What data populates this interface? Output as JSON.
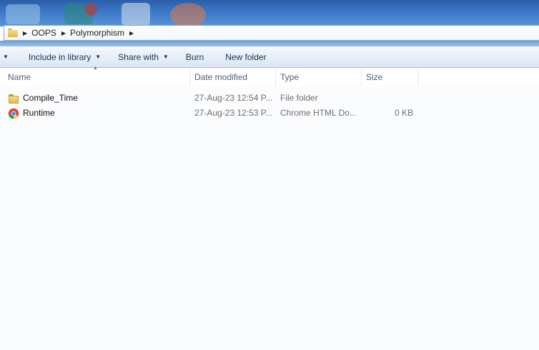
{
  "addressbar": {
    "crumbs": [
      {
        "label": "OOPS"
      },
      {
        "label": "Polymorphism"
      }
    ]
  },
  "toolbar": {
    "include_in_library": "Include in library",
    "share_with": "Share with",
    "burn": "Burn",
    "new_folder": "New folder"
  },
  "columns": {
    "name": "Name",
    "date_modified": "Date modified",
    "type": "Type",
    "size": "Size"
  },
  "files": [
    {
      "name": "Compile_Time",
      "date_modified": "27-Aug-23 12:54 P...",
      "type": "File folder",
      "size": "",
      "icon": "folder-icon"
    },
    {
      "name": "Runtime",
      "date_modified": "27-Aug-23 12:53 P...",
      "type": "Chrome HTML Do...",
      "size": "0 KB",
      "icon": "chrome-icon"
    }
  ],
  "colors": {
    "toolbar_text": "#1e3250",
    "header_text": "#4c607a",
    "detail_text": "#6d6d6d"
  }
}
